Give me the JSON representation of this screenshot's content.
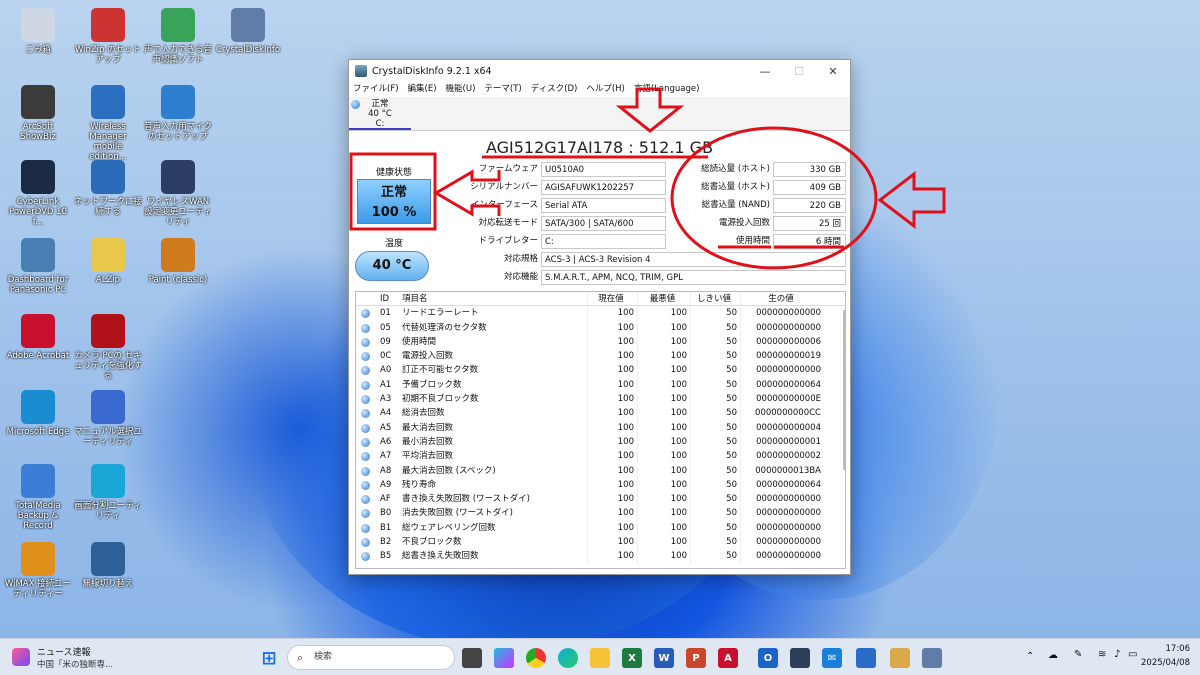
{
  "desktop_icons": [
    {
      "label": "ごみ箱",
      "icon": "recycle-bin-icon",
      "color": "#cfd8e2"
    },
    {
      "label": "ArcSoft ShowBiz",
      "icon": "showbiz-icon",
      "color": "#3b3b3b"
    },
    {
      "label": "CyberLink PowerDVD 10 f...",
      "icon": "powerdvd-icon",
      "color": "#1d2a44"
    },
    {
      "label": "Dashboard for Panasonic PC",
      "icon": "dashboard-icon",
      "color": "#4a7fb4"
    },
    {
      "label": "Adobe Acrobat",
      "icon": "acrobat-icon",
      "color": "#c8102e"
    },
    {
      "label": "Microsoft Edge",
      "icon": "edge-icon",
      "color": "#1a8dd0"
    },
    {
      "label": "TotalMedia Backup & Record",
      "icon": "totalmedia-icon",
      "color": "#3c7dd6"
    },
    {
      "label": "WiMAX 接続ユーティリティー",
      "icon": "wimax-icon",
      "color": "#e08f1a"
    },
    {
      "label": "WinZip のセットアップ",
      "icon": "winzip-setup-icon",
      "color": "#c33"
    },
    {
      "label": "Wireless Manager mobile edition...",
      "icon": "wireless-manager-icon",
      "color": "#2b6fc0"
    },
    {
      "label": "ネットワークに接続する",
      "icon": "network-connect-icon",
      "color": "#2a6cb8"
    },
    {
      "label": "ALZip",
      "icon": "alzip-icon",
      "color": "#e8c84a"
    },
    {
      "label": "カメラ·PCの セキュリティを強化する",
      "icon": "mcafee-icon",
      "color": "#b0121a"
    },
    {
      "label": "マニュアル選択ユーティリティ",
      "icon": "manual-icon",
      "color": "#3a6ad0"
    },
    {
      "label": "画面分割ユーティリティ",
      "icon": "screen-split-icon",
      "color": "#1aa7d8"
    },
    {
      "label": "無線切り替え",
      "icon": "wireless-toggle-icon",
      "color": "#2d5f99"
    },
    {
      "label": "声で入力できる音声認識ソフト",
      "icon": "voice-input-icon",
      "color": "#3aa35a"
    },
    {
      "label": "音声入力用マイクのセットアップ",
      "icon": "mic-setup-icon",
      "color": "#2f7fd0"
    },
    {
      "label": "ワイヤレスWAN設定変更ユーティリティ",
      "icon": "wireless-wan-icon",
      "color": "#2c3e66"
    },
    {
      "label": "Paint (classic)",
      "icon": "paint-icon",
      "color": "#d07a20"
    },
    {
      "label": "CrystalDiskInfo",
      "icon": "crystaldiskinfo-icon",
      "color": "#5f7da8"
    }
  ],
  "window": {
    "title": "CrystalDiskInfo 9.2.1 x64",
    "menu": [
      "ファイル(F)",
      "編集(E)",
      "機能(U)",
      "テーマ(T)",
      "ディスク(D)",
      "ヘルプ(H)",
      "言語(Language)"
    ],
    "drive_tab": {
      "status": "正常",
      "temp": "40 °C",
      "letter": "C:"
    },
    "model": "AGI512G17AI178 : 512.1 GB",
    "health_label": "健康状態",
    "health_status": "正常",
    "health_percent": "100 %",
    "temp_label": "温度",
    "temp_value": "40 °C",
    "left_info": [
      {
        "k": "ファームウェア",
        "v": "U0510A0"
      },
      {
        "k": "シリアルナンバー",
        "v": "AGISAFUWK1202257"
      },
      {
        "k": "インターフェース",
        "v": "Serial ATA"
      },
      {
        "k": "対応転送モード",
        "v": "SATA/300 | SATA/600"
      },
      {
        "k": "ドライブレター",
        "v": "C:"
      }
    ],
    "right_info": [
      {
        "k": "総読込量 (ホスト)",
        "v": "330 GB"
      },
      {
        "k": "総書込量 (ホスト)",
        "v": "409 GB"
      },
      {
        "k": "総書込量 (NAND)",
        "v": "220 GB"
      },
      {
        "k": "電源投入回数",
        "v": "25 回"
      },
      {
        "k": "使用時間",
        "v": "6 時間"
      }
    ],
    "standard_label": "対応規格",
    "standard_value": "ACS-3 | ACS-3 Revision 4",
    "features_label": "対応機能",
    "features_value": "S.M.A.R.T., APM, NCQ, TRIM, GPL",
    "table_headers": [
      "ID",
      "項目名",
      "現在値",
      "最悪値",
      "しきい値",
      "生の値"
    ],
    "smart": [
      [
        "01",
        "リードエラーレート",
        "100",
        "100",
        "50",
        "000000000000"
      ],
      [
        "05",
        "代替処理済のセクタ数",
        "100",
        "100",
        "50",
        "000000000000"
      ],
      [
        "09",
        "使用時間",
        "100",
        "100",
        "50",
        "000000000006"
      ],
      [
        "0C",
        "電源投入回数",
        "100",
        "100",
        "50",
        "000000000019"
      ],
      [
        "A0",
        "訂正不可能セクタ数",
        "100",
        "100",
        "50",
        "000000000000"
      ],
      [
        "A1",
        "予備ブロック数",
        "100",
        "100",
        "50",
        "000000000064"
      ],
      [
        "A3",
        "初期不良ブロック数",
        "100",
        "100",
        "50",
        "00000000000E"
      ],
      [
        "A4",
        "総消去回数",
        "100",
        "100",
        "50",
        "0000000000CC"
      ],
      [
        "A5",
        "最大消去回数",
        "100",
        "100",
        "50",
        "000000000004"
      ],
      [
        "A6",
        "最小消去回数",
        "100",
        "100",
        "50",
        "000000000001"
      ],
      [
        "A7",
        "平均消去回数",
        "100",
        "100",
        "50",
        "000000000002"
      ],
      [
        "A8",
        "最大消去回数 (スペック)",
        "100",
        "100",
        "50",
        "0000000013BA"
      ],
      [
        "A9",
        "残り寿命",
        "100",
        "100",
        "50",
        "000000000064"
      ],
      [
        "AF",
        "書き換え失敗回数 (ワーストダイ)",
        "100",
        "100",
        "50",
        "000000000000"
      ],
      [
        "B0",
        "消去失敗回数 (ワーストダイ)",
        "100",
        "100",
        "50",
        "000000000000"
      ],
      [
        "B1",
        "総ウェアレベリング回数",
        "100",
        "100",
        "50",
        "000000000000"
      ],
      [
        "B2",
        "不良ブロック数",
        "100",
        "100",
        "50",
        "000000000000"
      ],
      [
        "B5",
        "総書き換え失敗回数",
        "100",
        "100",
        "50",
        "000000000000"
      ]
    ]
  },
  "taskbar": {
    "news_title": "ニュース速報",
    "news_sub": "中国「米の独断専...",
    "search_placeholder": "検索",
    "time": "17:06",
    "date": "2025/04/08"
  },
  "colors": {
    "annotation": "#e0101a",
    "health": "#3c9ae8",
    "accent": "#2a78d6"
  }
}
